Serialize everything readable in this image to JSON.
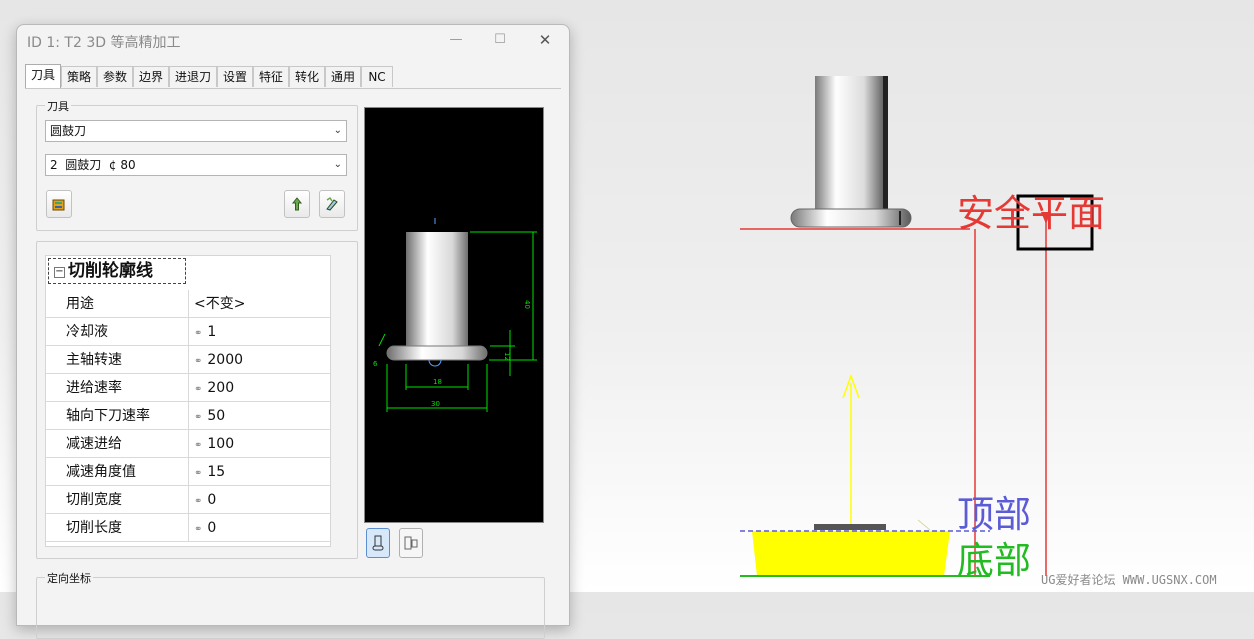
{
  "window": {
    "title": "ID 1: T2 3D 等高精加工",
    "minimize": "—",
    "maximize": "☐",
    "close": "✕"
  },
  "tabs": [
    "刀具",
    "策略",
    "参数",
    "边界",
    "进退刀",
    "设置",
    "特征",
    "转化",
    "通用",
    "NC"
  ],
  "active_tab": "刀具",
  "tool_group": {
    "label": "刀具",
    "tool_type": "圆鼓刀",
    "tool_select": "2  圆鼓刀  ¢ 80"
  },
  "cut_params": {
    "header": "切削轮廓线",
    "rows": [
      {
        "name": "用途",
        "value": "<不变>",
        "linked": false
      },
      {
        "name": "冷却液",
        "value": "1",
        "linked": true
      },
      {
        "name": "主轴转速",
        "value": "2000",
        "linked": true
      },
      {
        "name": "进给速率",
        "value": "200",
        "linked": true
      },
      {
        "name": "轴向下刀速率",
        "value": "50",
        "linked": true
      },
      {
        "name": "减速进给",
        "value": "100",
        "linked": true
      },
      {
        "name": "减速角度值",
        "value": "15",
        "linked": true
      },
      {
        "name": "切削宽度",
        "value": "0",
        "linked": true
      },
      {
        "name": "切削长度",
        "value": "0",
        "linked": true
      }
    ]
  },
  "orient_group": {
    "label": "定向坐标"
  },
  "preview_dims": {
    "d1": "18",
    "d2": "30",
    "h": "40",
    "r": "12",
    "a": "6"
  },
  "scene": {
    "safe_plane": "安全平面",
    "top": "顶部",
    "bottom": "底部"
  },
  "watermark": "UG爱好者论坛 WWW.UGSNX.COM",
  "colors": {
    "red": "#e53935",
    "blue": "#5b5bd6",
    "green": "#22bb22",
    "yellow": "#ffff00",
    "dim_green": "#00e000"
  }
}
